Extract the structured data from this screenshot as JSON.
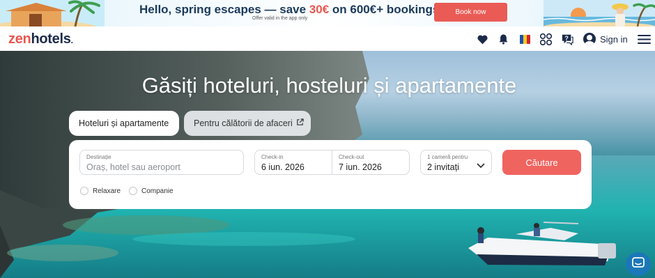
{
  "promo": {
    "headline_before": "Hello, spring escapes — save ",
    "headline_accent": "30€",
    "headline_after": " on 600€+ bookings",
    "subtext": "Offer valid in the app only",
    "cta_label": "Book now",
    "accent_color": "#e8574f",
    "cta_color": "#ea5b56"
  },
  "nav": {
    "logo_zen": "zen",
    "logo_rest": "hotels",
    "icons": [
      "heart-icon",
      "bell-icon",
      "romania-flag-icon",
      "currency-icon",
      "help-chat-icon",
      "avatar-icon",
      "menu-icon"
    ],
    "signin_label": "Sign in"
  },
  "hero": {
    "title": "Găsiți hoteluri, hosteluri și apartamente",
    "tabs": [
      {
        "label": "Hoteluri și apartamente",
        "active": true
      },
      {
        "label": "Pentru călătorii de afaceri",
        "active": false,
        "icon": "external-link-icon"
      }
    ],
    "form": {
      "destination": {
        "label": "Destinație",
        "placeholder": "Oraș, hotel sau aeroport"
      },
      "checkin": {
        "label": "Check-in",
        "value": "6 iun. 2026"
      },
      "checkout": {
        "label": "Check-out",
        "value": "7 iun. 2026"
      },
      "guests": {
        "label": "1 cameră pentru",
        "value": "2 invitați"
      },
      "search_label": "Căutare",
      "search_color": "#f0645f",
      "trip_types": [
        "Relaxare",
        "Companie"
      ]
    }
  },
  "chat": {
    "icon": "chat-icon",
    "color": "#1b78b8"
  }
}
